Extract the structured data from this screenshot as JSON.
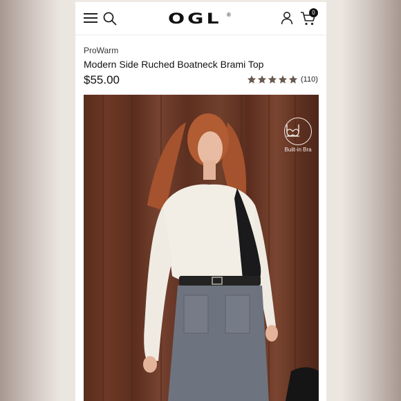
{
  "header": {
    "logo": "OGL",
    "logo_mark": "®",
    "cart_count": "0",
    "icons": [
      "hamburger-menu-icon",
      "search-icon",
      "user-icon",
      "cart-icon"
    ]
  },
  "product": {
    "brand": "ProWarm",
    "title": "Modern Side Ruched Boatneck Brami Top",
    "price": "$55.00",
    "rating": 5,
    "rating_max": 5,
    "review_count": "(110)"
  },
  "photo": {
    "badge_label": "Built-in Bra",
    "badge_icon": "bra-outline-icon"
  },
  "colors": {
    "star": "#6b5a4e",
    "text": "#111111",
    "wood": "#6a3624"
  }
}
